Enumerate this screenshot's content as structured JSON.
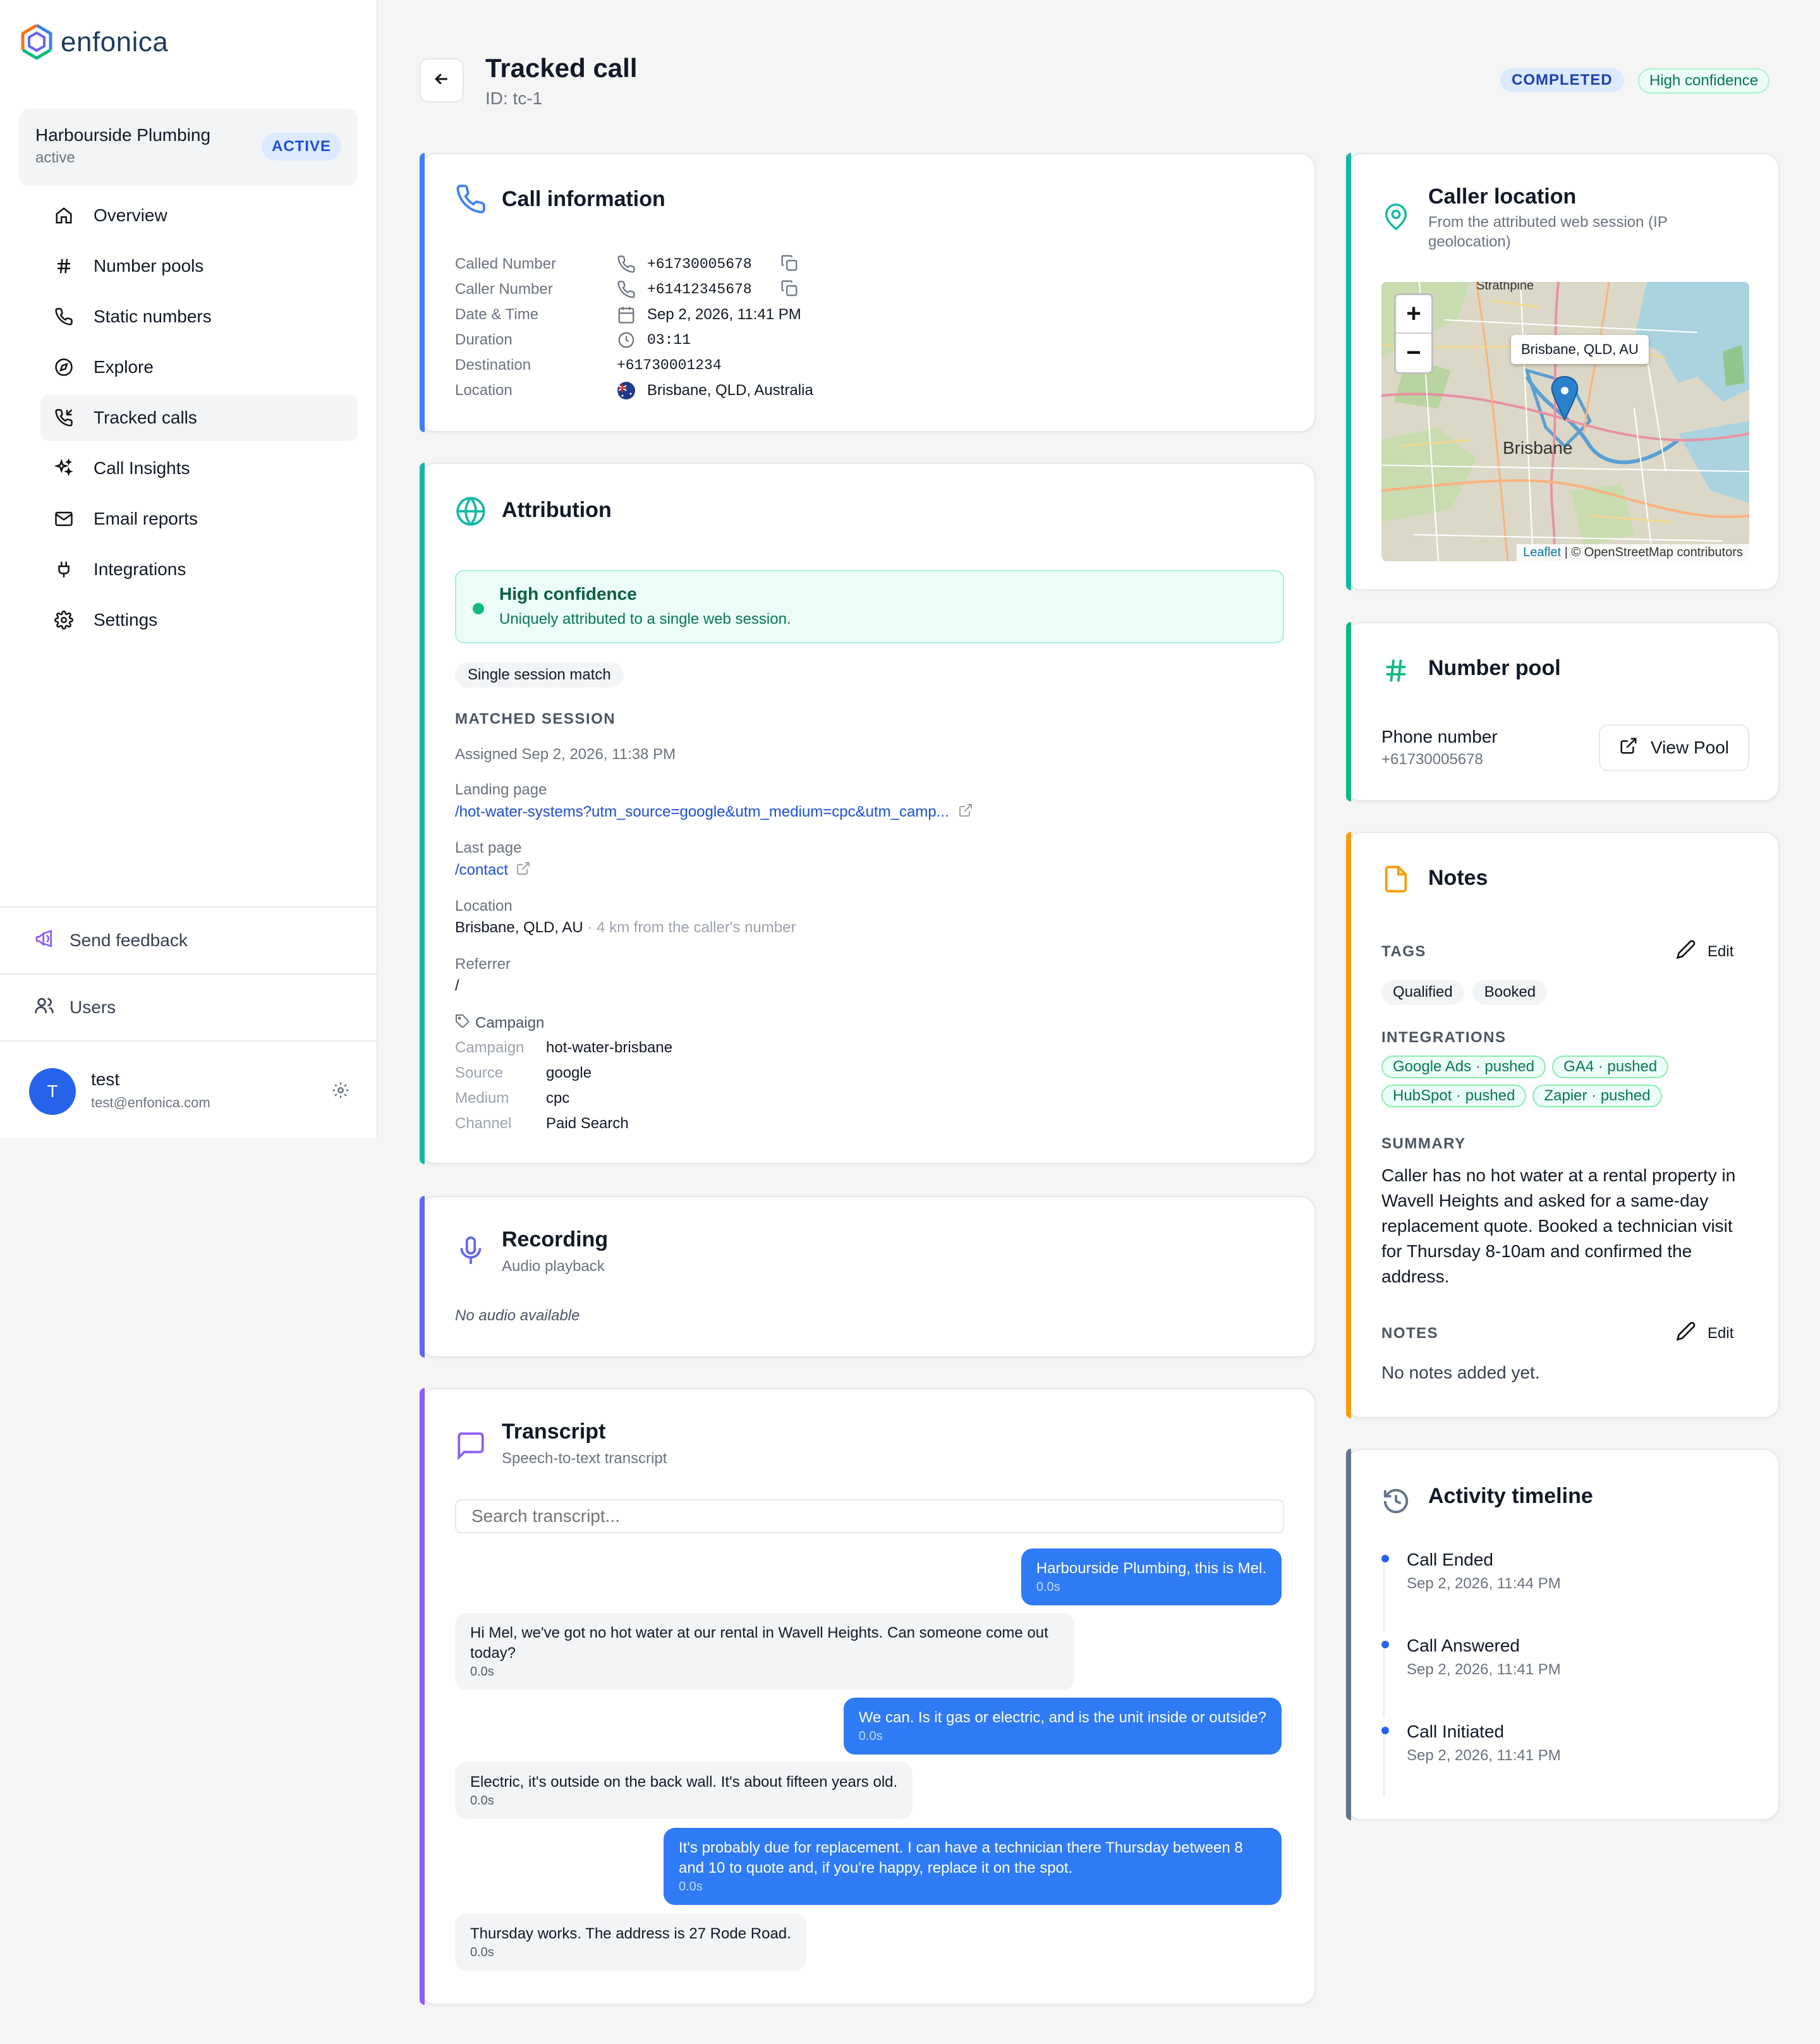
{
  "brand": {
    "name": "enfonica"
  },
  "org": {
    "name": "Harbourside Plumbing",
    "status": "active",
    "badge": "ACTIVE"
  },
  "nav": [
    {
      "label": "Overview",
      "icon": "home-icon"
    },
    {
      "label": "Number pools",
      "icon": "hash-icon"
    },
    {
      "label": "Static numbers",
      "icon": "phone-icon"
    },
    {
      "label": "Explore",
      "icon": "compass-icon"
    },
    {
      "label": "Tracked calls",
      "icon": "phone-incoming-icon",
      "active": true
    },
    {
      "label": "Call Insights",
      "icon": "sparkles-icon"
    },
    {
      "label": "Email reports",
      "icon": "mail-icon"
    },
    {
      "label": "Integrations",
      "icon": "plug-icon"
    },
    {
      "label": "Settings",
      "icon": "gear-icon"
    }
  ],
  "sidebar_footer": {
    "feedback": "Send feedback",
    "users": "Users"
  },
  "user": {
    "initial": "T",
    "name": "test",
    "email": "test@enfonica.com"
  },
  "header": {
    "title": "Tracked call",
    "id": "ID: tc-1",
    "status": "COMPLETED",
    "confidence": "High confidence"
  },
  "call_info": {
    "title": "Call information",
    "called_label": "Called Number",
    "called": "+61730005678",
    "caller_label": "Caller Number",
    "caller": "+61412345678",
    "datetime_label": "Date & Time",
    "datetime": "Sep 2, 2026, 11:41 PM",
    "duration_label": "Duration",
    "duration": "03:11",
    "destination_label": "Destination",
    "destination": "+61730001234",
    "location_label": "Location",
    "location": "Brisbane, QLD, Australia"
  },
  "attribution": {
    "title": "Attribution",
    "confidence_title": "High confidence",
    "confidence_sub": "Uniquely attributed to a single web session.",
    "match_chip": "Single session match",
    "matched_heading": "MATCHED SESSION",
    "assigned": "Assigned Sep 2, 2026, 11:38 PM",
    "landing_label": "Landing page",
    "landing_url": "/hot-water-systems?utm_source=google&utm_medium=cpc&utm_camp...",
    "last_label": "Last page",
    "last_url": "/contact",
    "location_label": "Location",
    "location": "Brisbane, QLD, AU",
    "location_note": "· 4 km from the caller's number",
    "referrer_label": "Referrer",
    "referrer": "/",
    "campaign_heading": "Campaign",
    "campaign_label": "Campaign",
    "campaign": "hot-water-brisbane",
    "source_label": "Source",
    "source": "google",
    "medium_label": "Medium",
    "medium": "cpc",
    "channel_label": "Channel",
    "channel": "Paid Search"
  },
  "recording": {
    "title": "Recording",
    "subtitle": "Audio playback",
    "empty": "No audio available"
  },
  "transcript": {
    "title": "Transcript",
    "subtitle": "Speech-to-text transcript",
    "search_placeholder": "Search transcript...",
    "messages": [
      {
        "speaker": "agent",
        "text": "Harbourside Plumbing, this is Mel.",
        "time": "0.0s"
      },
      {
        "speaker": "caller",
        "text": "Hi Mel, we've got no hot water at our rental in Wavell Heights. Can someone come out today?",
        "time": "0.0s"
      },
      {
        "speaker": "agent",
        "text": "We can. Is it gas or electric, and is the unit inside or outside?",
        "time": "0.0s"
      },
      {
        "speaker": "caller",
        "text": "Electric, it's outside on the back wall. It's about fifteen years old.",
        "time": "0.0s"
      },
      {
        "speaker": "agent",
        "text": "It's probably due for replacement. I can have a technician there Thursday between 8 and 10 to quote and, if you're happy, replace it on the spot.",
        "time": "0.0s"
      },
      {
        "speaker": "caller",
        "text": "Thursday works. The address is 27 Rode Road.",
        "time": "0.0s"
      }
    ]
  },
  "caller_location": {
    "title": "Caller location",
    "subtitle": "From the attributed web session (IP geolocation)",
    "marker_label": "Brisbane, QLD, AU",
    "map_city": "Brisbane",
    "map_suburb": "Strathpine",
    "zoom_in": "+",
    "zoom_out": "−",
    "attrib_link": "Leaflet",
    "attrib_text": "| © OpenStreetMap contributors"
  },
  "number_pool": {
    "title": "Number pool",
    "phone_label": "Phone number",
    "phone": "+61730005678",
    "button": "View Pool"
  },
  "notes": {
    "title": "Notes",
    "tags_heading": "TAGS",
    "edit": "Edit",
    "tags": [
      "Qualified",
      "Booked"
    ],
    "integrations_heading": "INTEGRATIONS",
    "integrations": [
      "Google Ads · pushed",
      "GA4 · pushed",
      "HubSpot · pushed",
      "Zapier · pushed"
    ],
    "summary_heading": "SUMMARY",
    "summary": "Caller has no hot water at a rental property in Wavell Heights and asked for a same-day replacement quote. Booked a technician visit for Thursday 8-10am and confirmed the address.",
    "notes_heading": "NOTES",
    "notes_empty": "No notes added yet."
  },
  "timeline": {
    "title": "Activity timeline",
    "events": [
      {
        "title": "Call Ended",
        "time": "Sep 2, 2026, 11:44 PM"
      },
      {
        "title": "Call Answered",
        "time": "Sep 2, 2026, 11:41 PM"
      },
      {
        "title": "Call Initiated",
        "time": "Sep 2, 2026, 11:41 PM"
      }
    ]
  },
  "colors": {
    "blue": "#3b82f6",
    "teal": "#14b8a6",
    "indigo": "#6366f1",
    "purple": "#8b5cf6",
    "orange": "#f59e0b",
    "slate": "#64748b"
  }
}
